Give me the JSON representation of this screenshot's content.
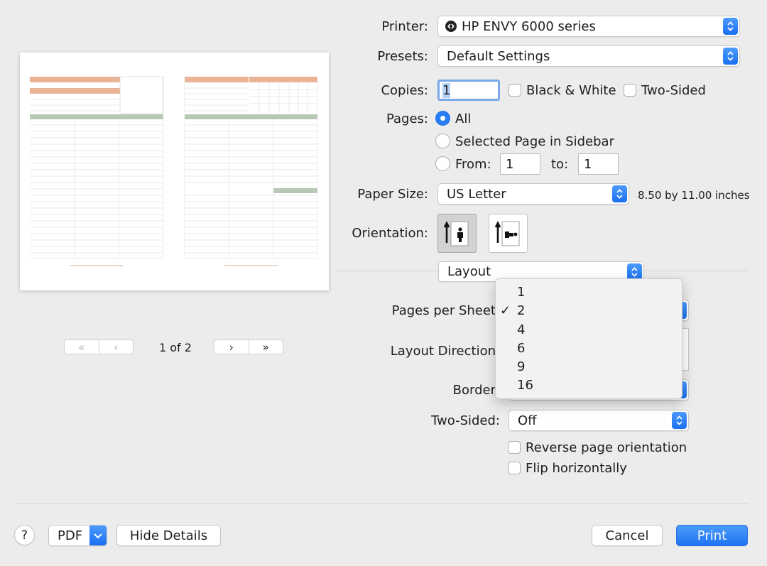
{
  "printer": {
    "label": "Printer:",
    "value": "HP ENVY 6000 series"
  },
  "presets": {
    "label": "Presets:",
    "value": "Default Settings"
  },
  "copies": {
    "label": "Copies:",
    "value": "1",
    "bw_label": "Black & White",
    "two_sided_label": "Two-Sided"
  },
  "pages": {
    "label": "Pages:",
    "all_label": "All",
    "selected_label": "Selected Page in Sidebar",
    "from_label": "From:",
    "from_value": "1",
    "to_label": "to:",
    "to_value": "1"
  },
  "paper": {
    "label": "Paper Size:",
    "value": "US Letter",
    "dims": "8.50 by 11.00 inches"
  },
  "orientation": {
    "label": "Orientation:"
  },
  "section": {
    "value": "Layout"
  },
  "layout": {
    "pages_per_sheet_label": "Pages per Sheet",
    "direction_label": "Layout Direction",
    "border_label": "Border",
    "two_sided_label": "Two-Sided:",
    "two_sided_value": "Off",
    "reverse_label": "Reverse page orientation",
    "flip_label": "Flip horizontally"
  },
  "menu": {
    "items": [
      "1",
      "2",
      "4",
      "6",
      "9",
      "16"
    ],
    "selected": "2",
    "check": "✓"
  },
  "preview": {
    "page_indicator": "1 of 2",
    "first": "«",
    "prev": "‹",
    "next": "›",
    "last": "»"
  },
  "footer": {
    "help": "?",
    "pdf": "PDF",
    "hide_details": "Hide Details",
    "cancel": "Cancel",
    "print": "Print"
  },
  "colors": {
    "accent": "#1a6ff0",
    "print_button": "#2f84f7",
    "sheet_orange": "#e8b495",
    "sheet_green": "#b7c9b4"
  },
  "icons": [
    "printer-status-icon",
    "chevron-updown-icon",
    "portrait-icon",
    "landscape-icon",
    "checkmark-icon",
    "chevron-down-icon"
  ]
}
